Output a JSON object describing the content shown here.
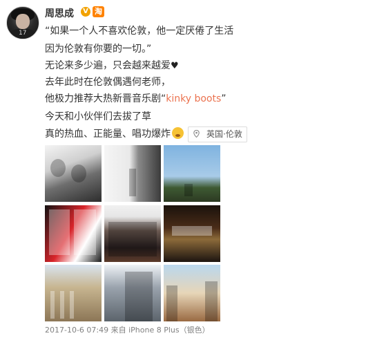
{
  "post": {
    "username": "周思成",
    "verified_badge": "V",
    "member_badge": "淘",
    "lines": {
      "l1": "“如果一个人不喜欢伦敦，他一定厌倦了生活",
      "l2": "因为伦敦有你要的一切。”",
      "l3": "无论来多少遍，只会越来越爱",
      "l4": "去年此时在伦敦偶遇何老师，",
      "l5_pre": "他极力推荐大热新晋音乐剧“",
      "l5_link": "kinky boots",
      "l5_post": "”",
      "l6": "今天和小伙伴们去拔了草",
      "l7": "真的热血、正能量、唱功爆炸"
    },
    "heart": "♥",
    "location": "英国·伦敦",
    "footer": "2017-10-6 07:49 来自 iPhone 8 Plus（银色）"
  },
  "icons": [
    "avatar",
    "verified-icon",
    "member-icon",
    "heart-icon",
    "shock-emoji-icon",
    "location-pin-icon"
  ],
  "colors": {
    "link": "#eb7350",
    "footer": "#808080",
    "vbadge": "#f2a200",
    "kbadge": "#ff8200"
  }
}
